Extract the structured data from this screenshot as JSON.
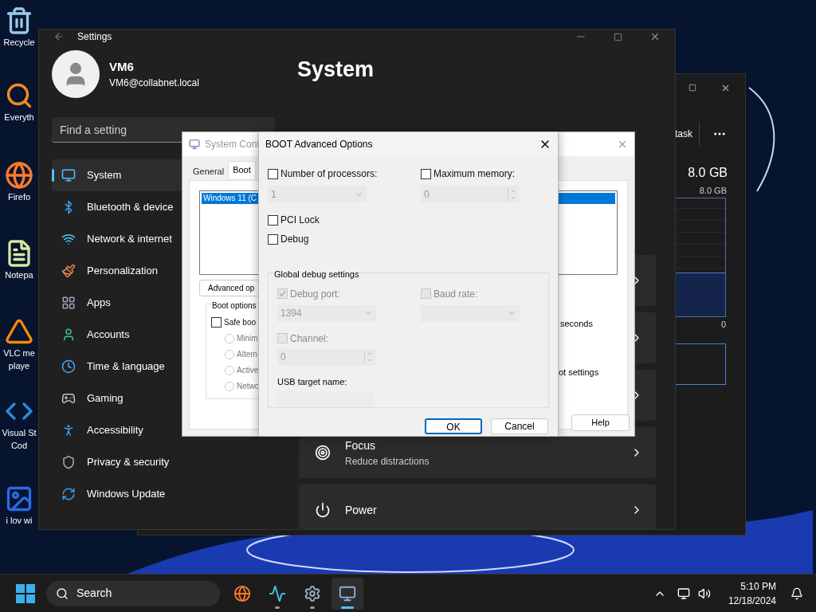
{
  "desktop_icons": [
    {
      "kind": "recycle",
      "lines": [
        "Recycle"
      ]
    },
    {
      "kind": "everything",
      "lines": [
        "Everyth"
      ]
    },
    {
      "kind": "firefox",
      "lines": [
        "Firefo"
      ]
    },
    {
      "kind": "notepad",
      "lines": [
        "Notepa"
      ]
    },
    {
      "kind": "vlc",
      "lines": [
        "VLC me",
        "playe"
      ]
    },
    {
      "kind": "vscode",
      "lines": [
        "Visual St",
        "Cod"
      ]
    },
    {
      "kind": "image",
      "lines": [
        "i lov wi"
      ]
    }
  ],
  "task_manager": {
    "toolbar_text": "task",
    "memory_total": "8.0 GB",
    "graph_max": "8.0 GB",
    "graph_min": "0"
  },
  "settings": {
    "title": "Settings",
    "user": {
      "name": "VM6",
      "email": "VM6@collabnet.local"
    },
    "search": {
      "placeholder": "Find a setting"
    },
    "nav": [
      {
        "kind": "system",
        "label": "System",
        "selected": true
      },
      {
        "kind": "bluetooth",
        "label": "Bluetooth & device",
        "selected": false
      },
      {
        "kind": "network",
        "label": "Network & internet",
        "selected": false
      },
      {
        "kind": "personalization",
        "label": "Personalization",
        "selected": false
      },
      {
        "kind": "apps",
        "label": "Apps",
        "selected": false
      },
      {
        "kind": "accounts",
        "label": "Accounts",
        "selected": false
      },
      {
        "kind": "time",
        "label": "Time & language",
        "selected": false
      },
      {
        "kind": "gaming",
        "label": "Gaming",
        "selected": false
      },
      {
        "kind": "accessibility",
        "label": "Accessibility",
        "selected": false
      },
      {
        "kind": "privacy",
        "label": "Privacy & security",
        "selected": false
      },
      {
        "kind": "update",
        "label": "Windows Update",
        "selected": false
      }
    ],
    "heading": "System",
    "cards": [
      {
        "kind": "hidden"
      },
      {
        "kind": "hidden"
      },
      {
        "kind": "hidden"
      },
      {
        "kind": "focus",
        "title": "Focus",
        "subtitle": "Reduce distractions"
      },
      {
        "kind": "power",
        "title": "Power"
      }
    ]
  },
  "system_config": {
    "title": "System Conf",
    "tabs": [
      {
        "label": "General",
        "selected": false
      },
      {
        "label": "Boot",
        "selected": true
      }
    ],
    "boot_entries": [
      {
        "label": "Windows 11 (C",
        "selected": true
      }
    ],
    "advanced_button": "Advanced op",
    "boot_options": {
      "title": "Boot options",
      "safe_boot": {
        "label": "Safe boo",
        "checked": false
      },
      "modes": [
        {
          "label": "Minim",
          "selected": false
        },
        {
          "label": "Altern",
          "selected": false
        },
        {
          "label": "Active",
          "selected": false
        },
        {
          "label": "Netwo",
          "selected": false
        }
      ]
    },
    "timeout_unit": "seconds",
    "permanent_label": "ot settings",
    "help_button": "Help"
  },
  "boot_advanced": {
    "title": "BOOT Advanced Options",
    "processors": {
      "label": "Number of processors:",
      "checked": false,
      "value": "1",
      "disabled": true
    },
    "max_memory": {
      "label": "Maximum memory:",
      "checked": false,
      "value": "0",
      "disabled": true
    },
    "pci_lock": {
      "label": "PCI Lock",
      "checked": false
    },
    "debug": {
      "label": "Debug",
      "checked": false
    },
    "global_debug": {
      "title": "Global debug settings",
      "debug_port": {
        "label": "Debug port:",
        "checked": true,
        "value": "1394",
        "disabled": true
      },
      "baud_rate": {
        "label": "Baud rate:",
        "checked": false,
        "disabled": true
      },
      "channel": {
        "label": "Channel:",
        "checked": false,
        "value": "0",
        "disabled": true
      },
      "usb_target_label": "USB target name:"
    },
    "buttons": [
      {
        "label": "OK",
        "default": true
      },
      {
        "label": "Cancel",
        "default": false
      }
    ]
  },
  "taskbar": {
    "search_placeholder": "Search",
    "apps": [
      {
        "kind": "firefox",
        "running": false,
        "active": false
      },
      {
        "kind": "taskmanager",
        "running": true,
        "active": false
      },
      {
        "kind": "settings",
        "running": true,
        "active": false
      },
      {
        "kind": "sysconfig",
        "running": true,
        "active": true
      }
    ],
    "time": "5:10 PM",
    "date": "12/18/2024"
  }
}
